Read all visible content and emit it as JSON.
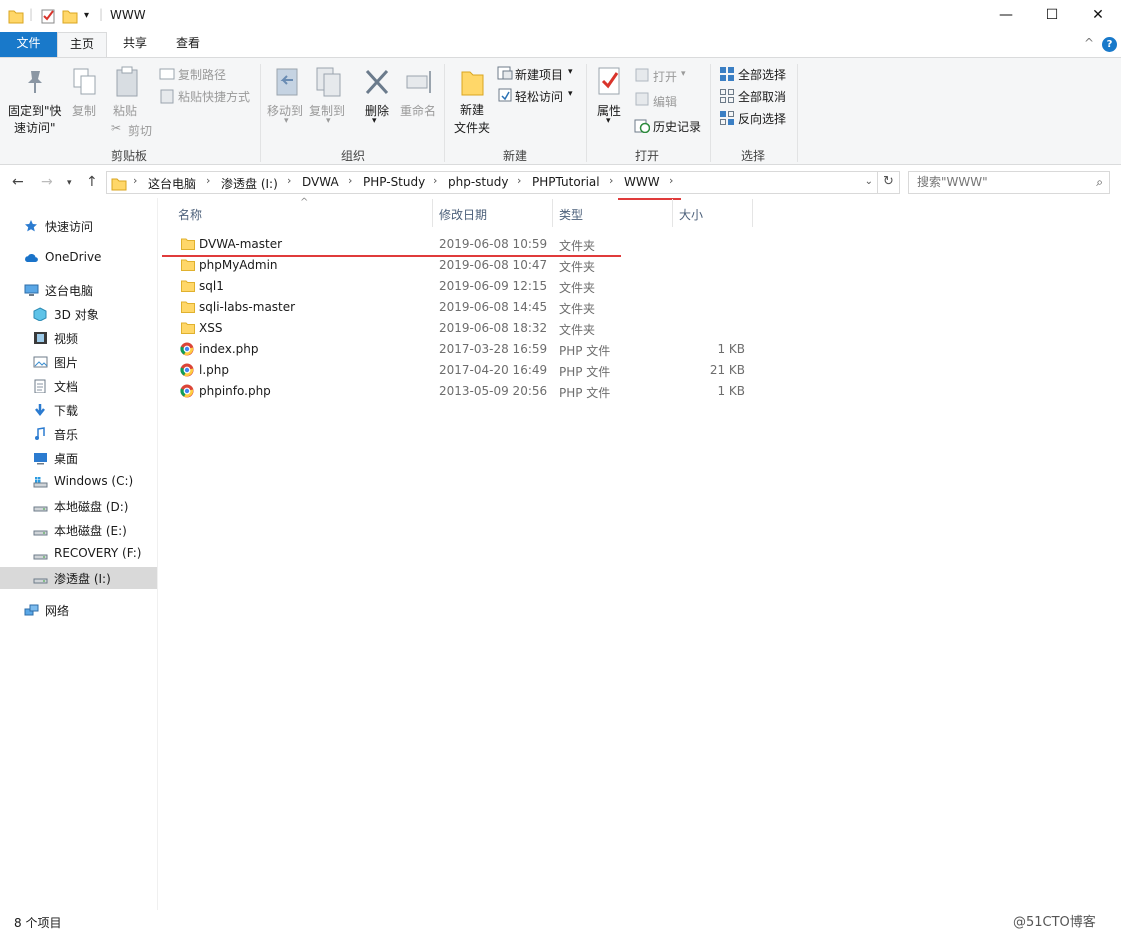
{
  "window": {
    "title": "WWW",
    "minimize_glyph": "—",
    "maximize_glyph": "☐",
    "close_glyph": "✕"
  },
  "tabs": {
    "file": "文件",
    "home": "主页",
    "share": "共享",
    "view": "查看",
    "collapse_glyph": "^",
    "help_glyph": "?"
  },
  "ribbon": {
    "clipboard": {
      "pin_label_1": "固定到\"快",
      "pin_label_2": "速访问\"",
      "copy": "复制",
      "paste": "粘贴",
      "copy_path": "复制路径",
      "paste_shortcut": "粘贴快捷方式",
      "cut": "剪切",
      "group": "剪贴板"
    },
    "organize": {
      "move_to": "移动到",
      "copy_to": "复制到",
      "delete": "删除",
      "rename": "重命名",
      "group": "组织"
    },
    "new": {
      "new_folder_1": "新建",
      "new_folder_2": "文件夹",
      "new_item": "新建项目",
      "easy_access": "轻松访问",
      "group": "新建"
    },
    "open": {
      "properties": "属性",
      "open": "打开",
      "edit": "编辑",
      "history": "历史记录",
      "group": "打开"
    },
    "select": {
      "select_all": "全部选择",
      "select_none": "全部取消",
      "invert": "反向选择",
      "group": "选择"
    }
  },
  "address": {
    "crumbs": [
      "这台电脑",
      "渗透盘 (I:)",
      "DVWA",
      "PHP-Study",
      "php-study",
      "PHPTutorial",
      "WWW"
    ],
    "search_placeholder": "搜索\"WWW\""
  },
  "nav": {
    "items": [
      {
        "label": "快速访问",
        "icon": "star-icon"
      },
      {
        "label": "OneDrive",
        "icon": "cloud-icon"
      },
      {
        "label": "这台电脑",
        "icon": "computer-icon"
      },
      {
        "label": "3D 对象",
        "icon": "cube-icon"
      },
      {
        "label": "视频",
        "icon": "video-icon"
      },
      {
        "label": "图片",
        "icon": "picture-icon"
      },
      {
        "label": "文档",
        "icon": "document-icon"
      },
      {
        "label": "下载",
        "icon": "download-icon"
      },
      {
        "label": "音乐",
        "icon": "music-icon"
      },
      {
        "label": "桌面",
        "icon": "desktop-icon"
      },
      {
        "label": "Windows (C:)",
        "icon": "windows-drive-icon"
      },
      {
        "label": "本地磁盘 (D:)",
        "icon": "drive-icon"
      },
      {
        "label": "本地磁盘 (E:)",
        "icon": "drive-icon"
      },
      {
        "label": "RECOVERY (F:)",
        "icon": "drive-icon"
      },
      {
        "label": "渗透盘 (I:)",
        "icon": "drive-icon",
        "selected": true
      },
      {
        "label": "网络",
        "icon": "network-icon"
      }
    ]
  },
  "columns": {
    "name": "名称",
    "modified": "修改日期",
    "type": "类型",
    "size": "大小"
  },
  "files": [
    {
      "name": "DVWA-master",
      "modified": "2019-06-08 10:59",
      "type": "文件夹",
      "size": "",
      "kind": "folder"
    },
    {
      "name": "phpMyAdmin",
      "modified": "2019-06-08 10:47",
      "type": "文件夹",
      "size": "",
      "kind": "folder"
    },
    {
      "name": "sql1",
      "modified": "2019-06-09 12:15",
      "type": "文件夹",
      "size": "",
      "kind": "folder"
    },
    {
      "name": "sqli-labs-master",
      "modified": "2019-06-08 14:45",
      "type": "文件夹",
      "size": "",
      "kind": "folder"
    },
    {
      "name": "XSS",
      "modified": "2019-06-08 18:32",
      "type": "文件夹",
      "size": "",
      "kind": "folder"
    },
    {
      "name": "index.php",
      "modified": "2017-03-28 16:59",
      "type": "PHP 文件",
      "size": "1 KB",
      "kind": "php"
    },
    {
      "name": "l.php",
      "modified": "2017-04-20 16:49",
      "type": "PHP 文件",
      "size": "21 KB",
      "kind": "php"
    },
    {
      "name": "phpinfo.php",
      "modified": "2013-05-09 20:56",
      "type": "PHP 文件",
      "size": "1 KB",
      "kind": "php"
    }
  ],
  "status": {
    "count": "8 个项目"
  },
  "watermark": "@51CTO博客",
  "colors": {
    "accent": "#1979ca",
    "annotation": "#e03b3b",
    "folder": "#ffd769"
  }
}
